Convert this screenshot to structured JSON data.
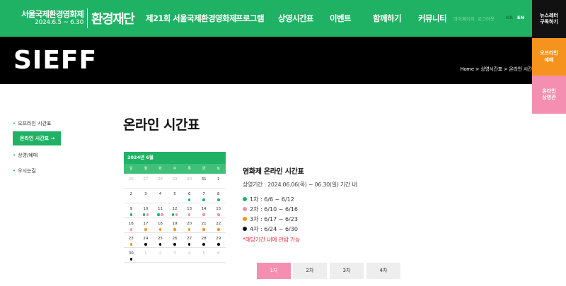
{
  "header": {
    "logo_line1": "서울국제환경영화제",
    "logo_line2": "2024.6.5 ~ 6.30",
    "logo_right": "환경재단",
    "nav": [
      "제21회 서울국제환경영화제",
      "프로그램",
      "상영시간표",
      "이벤트",
      "함께하기",
      "커뮤니티"
    ],
    "util": [
      "마이페이지",
      "로그아웃"
    ],
    "lang": [
      "KR",
      "EN"
    ]
  },
  "side_buttons": {
    "news": "뉴스레터\n구독하기",
    "offline": "오프라인\n예매",
    "online": "온라인\n상영관"
  },
  "band": {
    "title": "SIEFF",
    "breadcrumb": "Home > 상영시간표 > 온라인 시간"
  },
  "lnb": {
    "bullet": "•",
    "items": [
      "오프라인 시간표",
      "온라인 시간표",
      "상영/예매",
      "오시는길"
    ],
    "active_arrow": "→"
  },
  "page_title": "온라인 시간표",
  "calendar": {
    "month_label": "2024년 6월",
    "weekdays": [
      "일",
      "월",
      "화",
      "수",
      "목",
      "금",
      "토"
    ],
    "weeks": [
      [
        {
          "d": "26",
          "m": true
        },
        {
          "d": "27",
          "m": true
        },
        {
          "d": "28",
          "m": true
        },
        {
          "d": "29",
          "m": true
        },
        {
          "d": "30",
          "m": true
        },
        {
          "d": "31"
        },
        {
          "d": "1"
        }
      ],
      [
        {
          "d": "2"
        },
        {
          "d": "3"
        },
        {
          "d": "4"
        },
        {
          "d": "5"
        },
        {
          "d": "6",
          "dots": [
            "g"
          ]
        },
        {
          "d": "7",
          "dots": [
            "g"
          ]
        },
        {
          "d": "8",
          "dots": [
            "g"
          ]
        }
      ],
      [
        {
          "d": "9",
          "dots": [
            "g"
          ]
        },
        {
          "d": "10",
          "dots": [
            "g",
            "p"
          ]
        },
        {
          "d": "11",
          "dots": [
            "g",
            "p"
          ]
        },
        {
          "d": "12",
          "dots": [
            "g",
            "p"
          ]
        },
        {
          "d": "13",
          "dots": [
            "p"
          ]
        },
        {
          "d": "14",
          "dots": [
            "p"
          ]
        },
        {
          "d": "15",
          "dots": [
            "p"
          ]
        }
      ],
      [
        {
          "d": "16",
          "dots": [
            "p"
          ]
        },
        {
          "d": "17",
          "dots": [
            "o"
          ]
        },
        {
          "d": "18",
          "dots": [
            "o"
          ]
        },
        {
          "d": "19",
          "dots": [
            "o"
          ]
        },
        {
          "d": "20",
          "dots": [
            "o"
          ]
        },
        {
          "d": "21",
          "dots": [
            "o"
          ]
        },
        {
          "d": "22",
          "dots": [
            "o"
          ]
        }
      ],
      [
        {
          "d": "23",
          "dots": [
            "o"
          ]
        },
        {
          "d": "24",
          "dots": [
            "b"
          ]
        },
        {
          "d": "25",
          "dots": [
            "b"
          ]
        },
        {
          "d": "26",
          "dots": [
            "b"
          ]
        },
        {
          "d": "27",
          "dots": [
            "b"
          ]
        },
        {
          "d": "28",
          "dots": [
            "b"
          ]
        },
        {
          "d": "29",
          "dots": [
            "b"
          ]
        }
      ],
      [
        {
          "d": "30",
          "dots": [
            "b"
          ]
        },
        {
          "d": "1",
          "m": true
        },
        {
          "d": "2",
          "m": true
        },
        {
          "d": "3",
          "m": true
        },
        {
          "d": "4",
          "m": true
        },
        {
          "d": "5",
          "m": true
        },
        {
          "d": "6",
          "m": true
        }
      ]
    ]
  },
  "info": {
    "title": "영화제 온라인 시간표",
    "period": "상영기간 : 2024.06.06(목) ~ 06.30(일) 기간 내",
    "rounds": [
      {
        "label": "1차 : 6/6 ~ 6/12",
        "color": "#1fb264"
      },
      {
        "label": "2차 : 6/10 ~ 6/16",
        "color": "#f48fb1"
      },
      {
        "label": "3차 : 6/17 ~ 6/23",
        "color": "#f6921e"
      },
      {
        "label": "4차 : 6/24 ~ 6/30",
        "color": "#111111"
      }
    ],
    "note": "*해당기간 내에 관람 가능"
  },
  "tabs": [
    "1차",
    "2차",
    "3차",
    "4차"
  ],
  "colors": {
    "brand_green": "#1fb264",
    "pink": "#f48fb1",
    "orange": "#f6921e",
    "black": "#111111"
  }
}
